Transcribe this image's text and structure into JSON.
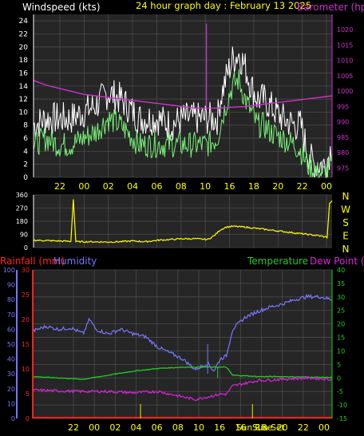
{
  "colors": {
    "background": "#000000",
    "plot_background": "#262626",
    "grid": "#4a4a4a",
    "axis_left": "#ffffff",
    "axis_right_baro": "#cc33cc",
    "ticks_x": "#ffff00",
    "wind": "#ffffff",
    "wind_avg": "#77ee77",
    "barometer": "#cc33cc",
    "direction": "#ffff00",
    "rain_axis": "#ff2222",
    "humidity": "#7777ff",
    "temperature": "#22cc22",
    "dewpoint": "#dd22dd",
    "sun_marker": "#cccc00"
  },
  "chart_data": [
    {
      "id": "wind-baro",
      "type": "line",
      "title": "24 hour graph day : February 13 2025",
      "ylabel_left": "Windspeed (kts)",
      "ylabel_right": "Barometer (hpa)",
      "x_tick_labels": [
        "22",
        "00",
        "02",
        "04",
        "06",
        "08",
        "10",
        "16",
        "18",
        "20",
        "22",
        "00"
      ],
      "ylim_left": [
        0,
        25
      ],
      "y_ticks_left": [
        0,
        2,
        4,
        6,
        8,
        10,
        12,
        14,
        16,
        18,
        20,
        22,
        24
      ],
      "ylim_right": [
        972,
        1025
      ],
      "y_ticks_right": [
        975,
        980,
        985,
        990,
        995,
        1000,
        1005,
        1010,
        1015,
        1020
      ],
      "x_range": [
        0,
        24
      ],
      "series": [
        {
          "kind": "gust",
          "x": [
            0,
            1,
            2,
            3,
            4,
            5,
            6,
            7,
            8,
            8.5,
            9,
            10,
            11,
            12,
            13,
            14,
            14.8,
            15,
            15.6,
            16,
            16.5,
            17,
            17.5,
            18,
            18.5,
            19,
            20,
            21,
            21.5,
            22,
            22.5,
            23,
            23.5,
            24
          ],
          "values": [
            8,
            9,
            9,
            9,
            10,
            11,
            13,
            12,
            10,
            9,
            9,
            9,
            8,
            9,
            9,
            9,
            9,
            12,
            16,
            18,
            19,
            17,
            14,
            12,
            12,
            11,
            9,
            8,
            8,
            4,
            2,
            2,
            2,
            5
          ]
        },
        {
          "kind": "average",
          "x": [
            0,
            1,
            2,
            3,
            4,
            5,
            6,
            7,
            8,
            8.5,
            9,
            10,
            11,
            12,
            13,
            14,
            14.8,
            15,
            15.6,
            16,
            16.5,
            17,
            17.5,
            18,
            18.5,
            19,
            20,
            21,
            21.5,
            22,
            22.5,
            23,
            23.5,
            24
          ],
          "values": [
            5,
            6,
            5,
            5,
            6,
            7,
            9,
            8,
            6,
            5,
            5,
            5,
            5,
            5,
            5,
            5,
            6,
            8,
            12,
            14,
            15,
            12,
            10,
            8,
            8,
            7,
            6,
            5,
            4,
            2,
            1,
            0.5,
            0.5,
            2
          ]
        },
        {
          "name": "Barometer",
          "axis": "right",
          "x": [
            0,
            1,
            2,
            3,
            4,
            5,
            6,
            7,
            8,
            9,
            10,
            11,
            12,
            13,
            14,
            15,
            16,
            17,
            18,
            19,
            20,
            21,
            22,
            23,
            24
          ],
          "values": [
            1003.5,
            1002,
            1001,
            1000,
            999,
            998.5,
            998,
            997.5,
            997,
            996.5,
            996,
            995.5,
            995,
            994.5,
            994.5,
            994.5,
            994.8,
            995,
            995.5,
            996,
            996.5,
            997,
            997.5,
            998,
            998.5
          ]
        }
      ],
      "annotations": [
        {
          "type": "spike",
          "x": 13.9,
          "value": 1022
        }
      ]
    },
    {
      "id": "direction",
      "type": "line",
      "ylabel_left": "",
      "y_ticks_left": [
        0,
        90,
        180,
        270,
        360
      ],
      "compass_labels": [
        "N",
        "W",
        "S",
        "E",
        "N"
      ],
      "ylim_left": [
        0,
        360
      ],
      "x_range": [
        0,
        24
      ],
      "series": [
        {
          "kind": "direction",
          "x": [
            0,
            2,
            3,
            3.2,
            3.4,
            4,
            6,
            7,
            8,
            9,
            10,
            11,
            12,
            13,
            14,
            14.5,
            15,
            15.5,
            16,
            17,
            18,
            19,
            20,
            21,
            22,
            23,
            23.6,
            23.8,
            24
          ],
          "values": [
            50,
            45,
            42,
            330,
            40,
            40,
            38,
            40,
            45,
            40,
            50,
            55,
            60,
            60,
            55,
            80,
            120,
            140,
            145,
            140,
            130,
            120,
            110,
            100,
            90,
            80,
            70,
            300,
            320
          ]
        }
      ]
    },
    {
      "id": "temp-hum",
      "type": "line",
      "ylabel_rain": "Rainfall (mm)",
      "ylabel_hum": "Humidity",
      "ylabel_temp": "Temperature",
      "ylabel_dew": "Dew Point (c)",
      "ylim_rain": [
        0,
        30
      ],
      "y_ticks_rain": [
        0,
        5,
        10,
        15,
        20,
        25,
        30
      ],
      "ylim_hum": [
        0,
        100
      ],
      "y_ticks_hum": [
        0,
        10,
        20,
        30,
        40,
        50,
        60,
        70,
        80,
        90,
        100
      ],
      "ylim_temp": [
        -15,
        40
      ],
      "y_ticks_temp": [
        -15,
        -10,
        -5,
        0,
        5,
        10,
        15,
        20,
        25,
        30,
        35,
        40
      ],
      "x_tick_labels": [
        "22",
        "00",
        "02",
        "04",
        "06",
        "08",
        "10",
        "16",
        "16",
        "18",
        "20",
        "22",
        "00"
      ],
      "sun_labels": [
        "Sun Rise",
        "Sun Set"
      ],
      "x_range": [
        0,
        24
      ],
      "series": [
        {
          "name": "Humidity",
          "axis": "hum",
          "x": [
            0,
            1,
            2,
            3,
            4,
            4.5,
            5,
            6,
            7,
            8,
            9,
            10,
            11,
            12,
            13,
            13.5,
            14,
            14.5,
            15,
            15.5,
            16,
            17,
            18,
            19,
            20,
            21,
            22,
            23,
            24
          ],
          "values": [
            59,
            62,
            60,
            61,
            57,
            67,
            60,
            57,
            60,
            57,
            55,
            48,
            44,
            40,
            33,
            35,
            37,
            32,
            40,
            42,
            60,
            68,
            72,
            75,
            77,
            80,
            82,
            82,
            80
          ]
        },
        {
          "name": "Temperature",
          "axis": "temp",
          "x": [
            0,
            2,
            4,
            6,
            8,
            10,
            12,
            14,
            15,
            15.5,
            16,
            17,
            18,
            20,
            22,
            24
          ],
          "values": [
            0.5,
            0,
            -0.5,
            1,
            2.5,
            3.5,
            4,
            4,
            4,
            4,
            1,
            0.8,
            0.5,
            0.5,
            0.3,
            0.2
          ]
        },
        {
          "name": "Dew Point",
          "axis": "temp",
          "x": [
            0,
            2,
            4,
            6,
            8,
            10,
            11,
            12,
            13,
            14,
            15,
            15.5,
            16,
            17,
            18,
            20,
            22,
            24
          ],
          "values": [
            -4.5,
            -4.8,
            -5,
            -5,
            -5.5,
            -5,
            -6,
            -7,
            -8,
            -7,
            -6,
            -6,
            -3,
            -2,
            -1,
            -0.5,
            0,
            -0.5
          ]
        },
        {
          "name": "Rainfall",
          "axis": "rain",
          "x": [
            0,
            24
          ],
          "values": [
            0,
            0
          ]
        }
      ],
      "markers": [
        {
          "label": "Sun Rise",
          "x": 8.6
        },
        {
          "label": "Sun Set",
          "x": 17.6
        }
      ]
    }
  ]
}
